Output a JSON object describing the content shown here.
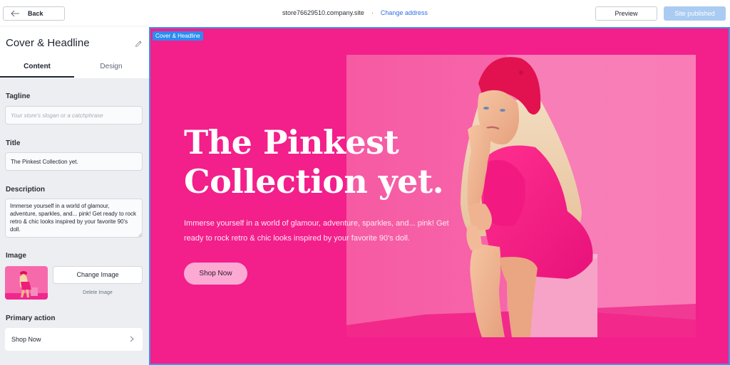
{
  "topbar": {
    "back_label": "Back",
    "site_address": "store76629510.company.site",
    "separator": "·",
    "change_address_label": "Change address",
    "preview_label": "Preview",
    "published_label": "Site published"
  },
  "sidebar": {
    "title": "Cover & Headline",
    "tabs": [
      {
        "label": "Content",
        "active": true
      },
      {
        "label": "Design",
        "active": false
      }
    ],
    "tagline": {
      "label": "Tagline",
      "value": "",
      "placeholder": "Your store's slogan or a catchphrase"
    },
    "title_field": {
      "label": "Title",
      "value": "The Pinkest Collection yet."
    },
    "description": {
      "label": "Description",
      "value": "Immerse yourself in a world of glamour, adventure, sparkles, and... pink! Get ready to rock retro & chic looks inspired by your favorite 90's doll."
    },
    "image": {
      "label": "Image",
      "change_label": "Change Image",
      "delete_label": "Delete Image"
    },
    "primary_action": {
      "label": "Primary action",
      "value": "Shop Now"
    }
  },
  "preview": {
    "section_badge": "Cover & Headline",
    "title": "The Pinkest Collection yet.",
    "description": "Immerse yourself in a world of glamour, adventure, sparkles, and... pink! Get ready to rock retro & chic looks inspired by your favorite 90's doll.",
    "cta_label": "Shop Now"
  },
  "colors": {
    "accent_blue": "#2b8cef",
    "hero_background": "#f31f8b",
    "cta_background": "#fcaad4",
    "published_button": "#aacbf2"
  },
  "icons": {
    "back": "arrow-left-icon",
    "edit": "pencil-icon",
    "chevron": "chevron-right-icon"
  }
}
